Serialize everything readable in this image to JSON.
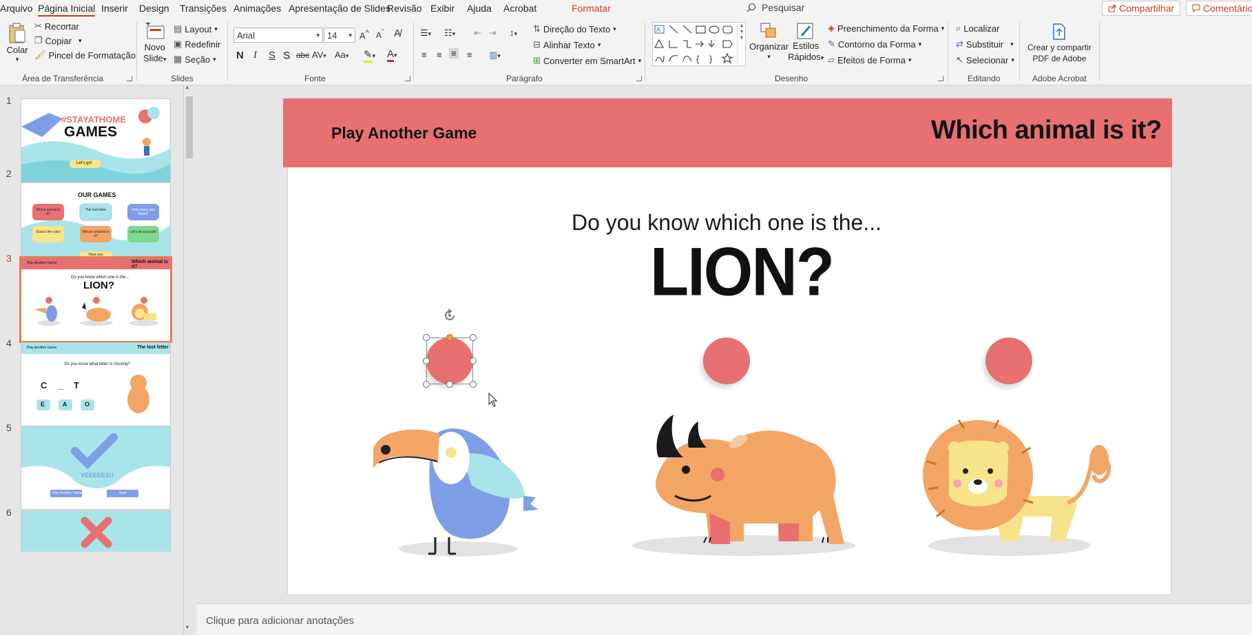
{
  "tabs": {
    "items": [
      "Arquivo",
      "Página Inicial",
      "Inserir",
      "Design",
      "Transições",
      "Animações",
      "Apresentação de Slides",
      "Revisão",
      "Exibir",
      "Ajuda",
      "Acrobat",
      "Formatar"
    ],
    "search": "Pesquisar",
    "share": "Compartilhar",
    "comments": "Comentários"
  },
  "ribbon": {
    "clipboard": {
      "paste": "Colar",
      "cut": "Recortar",
      "copy": "Copiar",
      "painter": "Pincel de Formatação",
      "label": "Área de Transferência"
    },
    "slides": {
      "new": "Novo",
      "new2": "Slide",
      "layout": "Layout",
      "reset": "Redefinir",
      "section": "Seção",
      "label": "Slides"
    },
    "font": {
      "name": "Arial",
      "size": "14",
      "label": "Fonte",
      "b": "N",
      "i": "I",
      "u": "S",
      "s": "S",
      "strike": "abc",
      "spacing": "AV",
      "case": "Aa",
      "color": "A"
    },
    "paragraph": {
      "direction": "Direção do Texto",
      "align": "Alinhar Texto",
      "smartart": "Converter em SmartArt",
      "label": "Parágrafo"
    },
    "drawing": {
      "arrange": "Organizar",
      "styles": "Estilos",
      "styles2": "Rápidos",
      "fill": "Preenchimento da Forma",
      "outline": "Contorno da Forma",
      "effects": "Efeitos de Forma",
      "label": "Desenho"
    },
    "editing": {
      "find": "Localizar",
      "replace": "Substituir",
      "select": "Selecionar",
      "label": "Editando"
    },
    "acrobat": {
      "create": "Crear y compartir",
      "create2": "PDF de Adobe",
      "label": "Adobe Acrobat"
    }
  },
  "thumbnails": [
    {
      "num": "1",
      "title": "#STAYATHOME",
      "title2": "GAMES",
      "button": "Let's go!"
    },
    {
      "num": "2",
      "title": "OUR GAMES",
      "cards": [
        "Which animal is it?",
        "The lost letter",
        "How many are there?",
        "Guess the color",
        "Whose shadow is it?",
        "Let's do a puzzle!"
      ],
      "footer": "Have you finished?"
    },
    {
      "num": "3",
      "left": "Play Another Game",
      "right": "Which animal is it?",
      "q": "Do you know which one is the...",
      "big": "LION?"
    },
    {
      "num": "4",
      "left": "Play Another Game",
      "right": "The lost letter",
      "q": "Do you know what letter is missing?",
      "letters": [
        "C",
        "_",
        "T"
      ],
      "options": [
        "E",
        "A",
        "O"
      ]
    },
    {
      "num": "5",
      "text": "YEEEEES!!",
      "buttons": [
        "Play Another Game",
        "Next"
      ]
    },
    {
      "num": "6"
    }
  ],
  "slide": {
    "banner_left": "Play Another Game",
    "banner_right": "Which animal is it?",
    "question": "Do you know which one is the...",
    "answer": "LION?"
  },
  "notes": "Clique para adicionar anotações",
  "colors": {
    "accent": "#c43e1c",
    "banner": "#e87070",
    "teal": "#a9e4e9",
    "blue": "#7f9ee8",
    "orange": "#f2a565",
    "yellow": "#f7e48a"
  }
}
